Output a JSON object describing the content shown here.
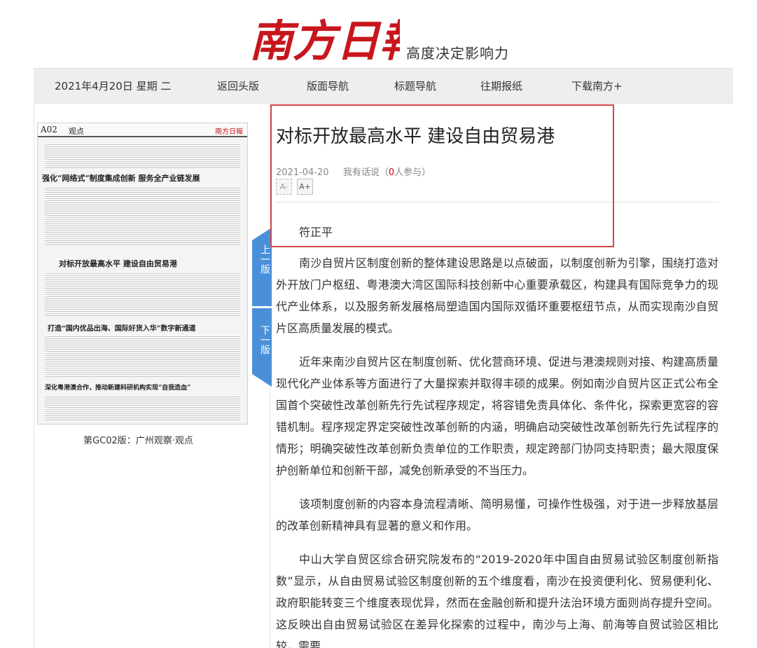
{
  "masthead": {
    "logo_text": "南方日報",
    "slogan": "高度决定影响力"
  },
  "nav": {
    "date": "2021年4月20日 星期 二",
    "items": [
      "返回头版",
      "版面导航",
      "标题导航",
      "往期报纸",
      "下载南方+"
    ]
  },
  "page_thumb": {
    "page_tag": "A02",
    "page_name": "观点",
    "headlines": [
      "强化“网络式”制度集成创新  服务全产业链发展",
      "对标开放最高水平  建设自由贸易港",
      "打造“国内优品出海、国际好货入华”数字新通道",
      "深化粤港澳合作，推动新建科研机构实现“自我造血”"
    ],
    "caption": "第GC02版：广州观察·观点"
  },
  "pager": {
    "up": "上一版",
    "down": "下一版"
  },
  "article": {
    "title": "对标开放最高水平 建设自由贸易港",
    "date": "2021-04-20",
    "comment_prefix": "我有话说（",
    "comment_count": "0",
    "comment_suffix": "人参与）",
    "font_smaller": "A-",
    "font_larger": "A+",
    "author": "符正平",
    "paragraphs": [
      "南沙自贸片区制度创新的整体建设思路是以点破面，以制度创新为引擎，围绕打造对外开放门户枢纽、粤港澳大湾区国际科技创新中心重要承载区，构建具有国际竞争力的现代产业体系，以及服务新发展格局塑造国内国际双循环重要枢纽节点，从而实现南沙自贸片区高质量发展的模式。",
      "近年来南沙自贸片区在制度创新、优化营商环境、促进与港澳规则对接、构建高质量现代化产业体系等方面进行了大量探索并取得丰硕的成果。例如南沙自贸片区正式公布全国首个突破性改革创新先行先试程序规定，将容错免责具体化、条件化，探索更宽容的容错机制。程序规定界定突破性改革创新的内涵，明确启动突破性改革创新先行先试程序的情形；明确突破性改革创新负责单位的工作职责，规定跨部门协同支持职责；最大限度保护创新单位和创新干部，减免创新承受的不当压力。",
      "该项制度创新的内容本身流程清晰、简明易懂，可操作性极强，对于进一步释放基层的改革创新精神具有显著的意义和作用。",
      "中山大学自贸区综合研究院发布的“2019-2020年中国自由贸易试验区制度创新指数”显示，从自由贸易试验区制度创新的五个维度看，南沙在投资便利化、贸易便利化、政府职能转变三个维度表现优异，然而在金融创新和提升法治环境方面则尚存提升空间。这反映出自由贸易试验区在差异化探索的过程中，南沙与上海、前海等自贸试验区相比较，需要"
    ]
  },
  "colors": {
    "logo_red": "#c8161d",
    "pager_blue": "#4a90d9",
    "highlight_red": "#d64545",
    "nav_bg": "#eeeeee"
  }
}
